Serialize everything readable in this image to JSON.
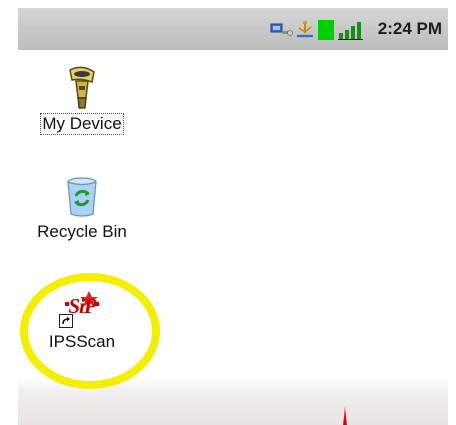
{
  "statusbar": {
    "time": "2:24 PM",
    "icons": [
      "network-connection-icon",
      "usb-connection-icon",
      "battery-icon",
      "signal-strength-icon"
    ],
    "battery_color": "#00d000"
  },
  "desktop": {
    "icons": [
      {
        "label": "My Device",
        "icon": "my-device-icon",
        "focused": true
      },
      {
        "label": "Recycle Bin",
        "icon": "recycle-bin-icon"
      },
      {
        "label": "IPSScan",
        "icon": "ipsscan-icon",
        "shortcut": true,
        "logo_text": "SiP"
      }
    ]
  },
  "annotation": {
    "type": "highlight-circle",
    "color": "#f4ee00",
    "target": "IPSScan"
  }
}
